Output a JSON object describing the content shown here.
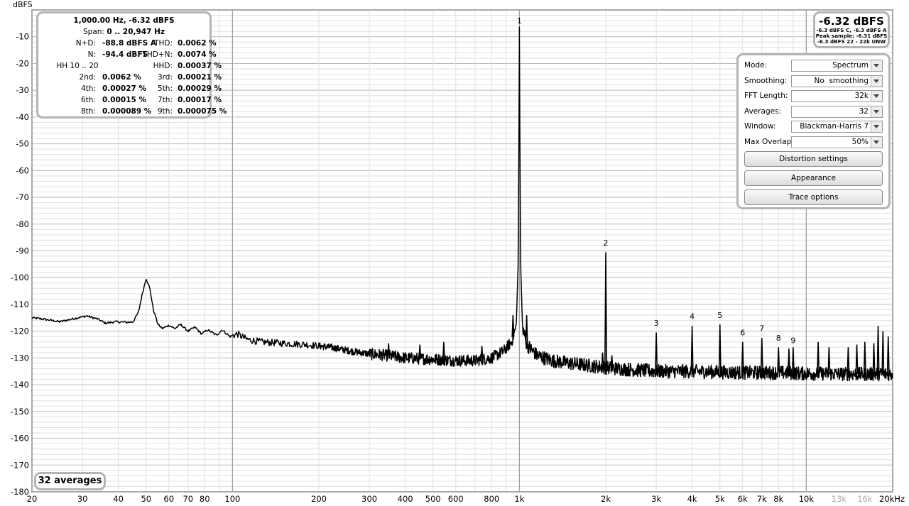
{
  "chart_data": {
    "type": "line",
    "title": "",
    "ylabel": "dBFS",
    "xlabel": "",
    "x_scale": "log",
    "xlim": [
      20,
      20000
    ],
    "ylim": [
      -180,
      0
    ],
    "grid": true,
    "y_ticks": [
      -10,
      -20,
      -30,
      -40,
      -50,
      -60,
      -70,
      -80,
      -90,
      -100,
      -110,
      -120,
      -130,
      -140,
      -150,
      -160,
      -170,
      -180
    ],
    "x_ticks": [
      {
        "value": 20,
        "label": "20",
        "faded": false
      },
      {
        "value": 30,
        "label": "30",
        "faded": false
      },
      {
        "value": 40,
        "label": "40",
        "faded": false
      },
      {
        "value": 50,
        "label": "50",
        "faded": false
      },
      {
        "value": 60,
        "label": "60",
        "faded": false
      },
      {
        "value": 70,
        "label": "70",
        "faded": false
      },
      {
        "value": 80,
        "label": "80",
        "faded": false
      },
      {
        "value": 100,
        "label": "100",
        "faded": false
      },
      {
        "value": 200,
        "label": "200",
        "faded": false
      },
      {
        "value": 300,
        "label": "300",
        "faded": false
      },
      {
        "value": 400,
        "label": "400",
        "faded": false
      },
      {
        "value": 500,
        "label": "500",
        "faded": false
      },
      {
        "value": 600,
        "label": "600",
        "faded": false
      },
      {
        "value": 800,
        "label": "800",
        "faded": false
      },
      {
        "value": 1000,
        "label": "1k",
        "faded": false
      },
      {
        "value": 2000,
        "label": "2k",
        "faded": false
      },
      {
        "value": 3000,
        "label": "3k",
        "faded": false
      },
      {
        "value": 4000,
        "label": "4k",
        "faded": false
      },
      {
        "value": 5000,
        "label": "5k",
        "faded": false
      },
      {
        "value": 6000,
        "label": "6k",
        "faded": false
      },
      {
        "value": 7000,
        "label": "7k",
        "faded": false
      },
      {
        "value": 8000,
        "label": "8k",
        "faded": false
      },
      {
        "value": 10000,
        "label": "10k",
        "faded": false
      },
      {
        "value": 13000,
        "label": "13k",
        "faded": true
      },
      {
        "value": 16000,
        "label": "16k",
        "faded": true
      },
      {
        "value": 20000,
        "label": "20kHz",
        "faded": false
      }
    ],
    "series": [
      {
        "points": [
          [
            20,
            -115
          ],
          [
            22,
            -115.5
          ],
          [
            25,
            -116.5
          ],
          [
            28,
            -115.3
          ],
          [
            31,
            -114.3
          ],
          [
            34,
            -115.5
          ],
          [
            36,
            -117
          ],
          [
            39,
            -116.5
          ],
          [
            43,
            -116.7
          ],
          [
            45,
            -116.5
          ],
          [
            47,
            -113
          ],
          [
            48.5,
            -106
          ],
          [
            50,
            -100.2
          ],
          [
            51.5,
            -104
          ],
          [
            53,
            -112
          ],
          [
            55,
            -117.5
          ],
          [
            57,
            -119
          ],
          [
            60,
            -117.8
          ],
          [
            63,
            -119
          ],
          [
            66,
            -117.5
          ],
          [
            70,
            -120
          ],
          [
            74,
            -118.5
          ],
          [
            78,
            -121
          ],
          [
            82,
            -119.5
          ],
          [
            88,
            -121.5
          ],
          [
            92,
            -119.5
          ],
          [
            98,
            -122
          ],
          [
            104,
            -121
          ],
          [
            112,
            -123
          ],
          [
            125,
            -124
          ],
          [
            150,
            -124.5
          ],
          [
            180,
            -125
          ],
          [
            220,
            -126
          ],
          [
            260,
            -127.5
          ],
          [
            300,
            -128.5
          ],
          [
            340,
            -129
          ],
          [
            400,
            -130
          ],
          [
            500,
            -130.5
          ],
          [
            600,
            -131
          ],
          [
            700,
            -131
          ],
          [
            800,
            -130
          ],
          [
            880,
            -127.5
          ],
          [
            940,
            -124
          ],
          [
            975,
            -118
          ],
          [
            990,
            -95
          ],
          [
            997,
            -40
          ],
          [
            1000,
            -6.4
          ],
          [
            1003,
            -40
          ],
          [
            1010,
            -95
          ],
          [
            1025,
            -118
          ],
          [
            1060,
            -125
          ],
          [
            1150,
            -129
          ],
          [
            1300,
            -131
          ],
          [
            1500,
            -132
          ],
          [
            1800,
            -133
          ],
          [
            2200,
            -134
          ],
          [
            3000,
            -135
          ],
          [
            4000,
            -135
          ],
          [
            6000,
            -135.5
          ],
          [
            8000,
            -135.5
          ],
          [
            10000,
            -135.8
          ],
          [
            14000,
            -136
          ],
          [
            18000,
            -136
          ],
          [
            20000,
            -136
          ]
        ]
      }
    ],
    "spikes": [
      [
        350,
        -124.5
      ],
      [
        450,
        -125
      ],
      [
        545,
        -124
      ],
      [
        740,
        -125.5
      ],
      [
        950,
        -114
      ],
      [
        1060,
        -114
      ],
      [
        1950,
        -128
      ],
      [
        2000,
        -90.5
      ],
      [
        2100,
        -129
      ],
      [
        3000,
        -120.5
      ],
      [
        4000,
        -118
      ],
      [
        5000,
        -117.5
      ],
      [
        6000,
        -124
      ],
      [
        7000,
        -122.5
      ],
      [
        8000,
        -126
      ],
      [
        8700,
        -126.5
      ],
      [
        9000,
        -126
      ],
      [
        11000,
        -124
      ],
      [
        12000,
        -126
      ],
      [
        14000,
        -126
      ],
      [
        15000,
        -125
      ],
      [
        16000,
        -124
      ],
      [
        17200,
        -124.5
      ],
      [
        17800,
        -118
      ],
      [
        18500,
        -120
      ],
      [
        19300,
        -122
      ]
    ],
    "annotations": [
      {
        "label": "1",
        "x": 1000,
        "y": -5
      },
      {
        "label": "2",
        "x": 2000,
        "y": -88
      },
      {
        "label": "3",
        "x": 3000,
        "y": -118
      },
      {
        "label": "4",
        "x": 4000,
        "y": -115.5
      },
      {
        "label": "5",
        "x": 5000,
        "y": -115
      },
      {
        "label": "6",
        "x": 6000,
        "y": -121.5
      },
      {
        "label": "7",
        "x": 7000,
        "y": -120
      },
      {
        "label": "8",
        "x": 8000,
        "y": -123.5
      },
      {
        "label": "9",
        "x": 9000,
        "y": -124.5
      }
    ]
  },
  "stats": {
    "line1": "1,000.00 Hz, -6.32 dBFS",
    "span_label": "Span:",
    "span_value": "0 .. 20,947 Hz",
    "rows": [
      {
        "l1": "N+D:",
        "v1": "-88.8 dBFS A",
        "l2": "THD:",
        "v2": "0.0062 %"
      },
      {
        "l1": "N:",
        "v1": "-94.4 dBFS",
        "l2": "THD+N:",
        "v2": "0.0074 %"
      },
      {
        "hh": "HH 10 .. 20",
        "l2": "HHD:",
        "v2": "0.00037 %"
      },
      {
        "l1": "2nd:",
        "v1": "0.0062 %",
        "l2": "3rd:",
        "v2": "0.00021 %"
      },
      {
        "l1": "4th:",
        "v1": "0.00027 %",
        "l2": "5th:",
        "v2": "0.00029 %"
      },
      {
        "l1": "6th:",
        "v1": "0.00015 %",
        "l2": "7th:",
        "v2": "0.00017 %"
      },
      {
        "l1": "8th:",
        "v1": "0.000089 %",
        "l2": "9th:",
        "v2": "0.000075 %"
      }
    ]
  },
  "level": {
    "value": "-6.32 dBFS",
    "line1": "-6.3 dBFS C, -6.3 dBFS A",
    "line2": "Peak sample: -6.31 dBFS",
    "line3": "-6.3 dBFS 22 - 22k UNW"
  },
  "controls": {
    "mode": {
      "label": "Mode:",
      "value": "Spectrum"
    },
    "smoothing": {
      "label": "Smoothing:",
      "value": "No  smoothing"
    },
    "fft_length": {
      "label": "FFT Length:",
      "value": "32k"
    },
    "averages": {
      "label": "Averages:",
      "value": "32"
    },
    "window": {
      "label": "Window:",
      "value": "Blackman-Harris 7"
    },
    "max_overlap": {
      "label": "Max Overlap:",
      "value": "50%"
    },
    "distortion_settings": "Distortion settings",
    "appearance": "Appearance",
    "trace_options": "Trace options"
  },
  "averages_badge": "32 averages",
  "colors": {
    "trace": "#000000",
    "major_grid": "#b9b9b9",
    "minor_grid": "#e0e0e0",
    "panel_border": "#b4b4b4"
  }
}
